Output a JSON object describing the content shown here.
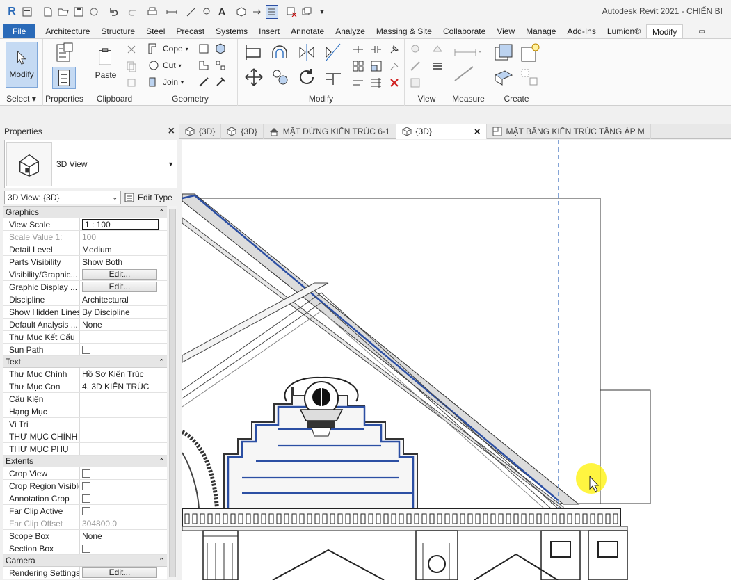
{
  "app": {
    "title": "Autodesk Revit 2021 - CHIẾN BI"
  },
  "quick_access": {
    "icons": [
      "revit-logo-icon",
      "open-project-icon",
      "new-icon",
      "open-icon",
      "save-icon",
      "sync-icon",
      "undo-icon",
      "redo-icon",
      "print-icon",
      "measure-icon",
      "dimension-icon",
      "tag-icon",
      "text-icon",
      "3d-view-icon",
      "section-icon",
      "thin-lines-icon",
      "close-hidden-icon",
      "switch-windows-icon",
      "customize-icon"
    ]
  },
  "ribbon_tabs": [
    "File",
    "Architecture",
    "Structure",
    "Steel",
    "Precast",
    "Systems",
    "Insert",
    "Annotate",
    "Analyze",
    "Massing & Site",
    "Collaborate",
    "View",
    "Manage",
    "Add-Ins",
    "Lumion®",
    "Modify"
  ],
  "active_tab": "Modify",
  "ribbon": {
    "select": {
      "button": "Modify",
      "label": "Select ▾"
    },
    "properties": {
      "label": "Properties"
    },
    "clipboard": {
      "paste": "Paste",
      "label": "Clipboard"
    },
    "geometry": {
      "cope": "Cope",
      "cut": "Cut",
      "join": "Join",
      "label": "Geometry"
    },
    "modify": {
      "label": "Modify"
    },
    "view": {
      "label": "View"
    },
    "measure": {
      "label": "Measure"
    },
    "create": {
      "label": "Create"
    }
  },
  "properties_panel": {
    "title": "Properties",
    "type_name": "3D View",
    "instance": "3D View: {3D}",
    "edit_type": "Edit Type",
    "sections": [
      {
        "name": "Graphics",
        "rows": [
          {
            "key": "View Scale",
            "value": "1 : 100",
            "kind": "input"
          },
          {
            "key": "Scale Value    1:",
            "value": "100",
            "kind": "dim"
          },
          {
            "key": "Detail Level",
            "value": "Medium"
          },
          {
            "key": "Parts Visibility",
            "value": "Show Both"
          },
          {
            "key": "Visibility/Graphic...",
            "value": "Edit...",
            "kind": "button"
          },
          {
            "key": "Graphic Display ...",
            "value": "Edit...",
            "kind": "button"
          },
          {
            "key": "Discipline",
            "value": "Architectural"
          },
          {
            "key": "Show Hidden Lines",
            "value": "By Discipline"
          },
          {
            "key": "Default Analysis ...",
            "value": "None"
          },
          {
            "key": "Thư Mục Kết Cấu",
            "value": ""
          },
          {
            "key": "Sun Path",
            "value": "",
            "kind": "check"
          }
        ]
      },
      {
        "name": "Text",
        "rows": [
          {
            "key": "Thư Mục Chính",
            "value": "Hồ Sơ Kiến Trúc"
          },
          {
            "key": "Thư Mục Con",
            "value": "4. 3D KIẾN TRÚC"
          },
          {
            "key": "Cấu Kiện",
            "value": ""
          },
          {
            "key": "Hạng Mục",
            "value": ""
          },
          {
            "key": "Vị Trí",
            "value": ""
          },
          {
            "key": "THƯ MỤC CHÍNH",
            "value": ""
          },
          {
            "key": "THƯ MỤC PHỤ",
            "value": ""
          }
        ]
      },
      {
        "name": "Extents",
        "rows": [
          {
            "key": "Crop View",
            "value": "",
            "kind": "check"
          },
          {
            "key": "Crop Region Visible",
            "value": "",
            "kind": "check"
          },
          {
            "key": "Annotation Crop",
            "value": "",
            "kind": "check"
          },
          {
            "key": "Far Clip Active",
            "value": "",
            "kind": "check"
          },
          {
            "key": "Far Clip Offset",
            "value": "304800.0",
            "kind": "dim"
          },
          {
            "key": "Scope Box",
            "value": "None"
          },
          {
            "key": "Section Box",
            "value": "",
            "kind": "check"
          }
        ]
      },
      {
        "name": "Camera",
        "rows": [
          {
            "key": "Rendering Settings",
            "value": "Edit...",
            "kind": "button"
          }
        ]
      }
    ]
  },
  "view_tabs": [
    {
      "label": "{3D}",
      "icon": "3d-view-icon",
      "active": false
    },
    {
      "label": "{3D}",
      "icon": "3d-view-icon",
      "active": false
    },
    {
      "label": "MẶT ĐỨNG KIẾN TRÚC 6-1",
      "icon": "elevation-icon",
      "active": false
    },
    {
      "label": "{3D}",
      "icon": "3d-view-icon",
      "active": true,
      "closable": true
    },
    {
      "label": "MẶT BẰNG KIẾN TRÚC TẦNG ÁP M",
      "icon": "plan-view-icon",
      "active": false
    }
  ],
  "colors": {
    "file_tab": "#2a6ab8",
    "selection_blue": "#2c4fa3",
    "cursor_highlight": "#fff200"
  }
}
